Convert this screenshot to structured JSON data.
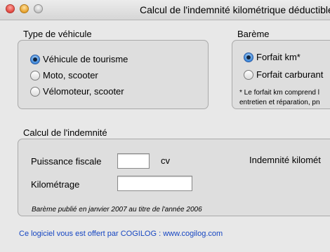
{
  "window": {
    "title": "Calcul de l'indemnité kilométrique déductible"
  },
  "vehicle_group": {
    "label": "Type de véhicule",
    "options": [
      {
        "label": "Véhicule de tourisme",
        "selected": true
      },
      {
        "label": "Moto, scooter",
        "selected": false
      },
      {
        "label": "Vélomoteur, scooter",
        "selected": false
      }
    ]
  },
  "bareme_group": {
    "label": "Barème",
    "options": [
      {
        "label": "Forfait km*",
        "selected": true
      },
      {
        "label": "Forfait carburant",
        "selected": false
      }
    ],
    "note_line1": "* Le forfait km comprend l",
    "note_line2": "entretien et réparation, pn"
  },
  "calc_group": {
    "label": "Calcul de l'indemnité",
    "puissance_label": "Puissance fiscale",
    "puissance_value": "",
    "puissance_unit": "cv",
    "km_label": "Kilométrage",
    "km_value": "",
    "indemnite_label": "Indemnité kilomét",
    "bareme_note": "Barème publié en janvier 2007 au titre de l'année 2006"
  },
  "footer": {
    "promo": "Ce logiciel vous est offert par COGILOG : www.cogilog.com"
  }
}
